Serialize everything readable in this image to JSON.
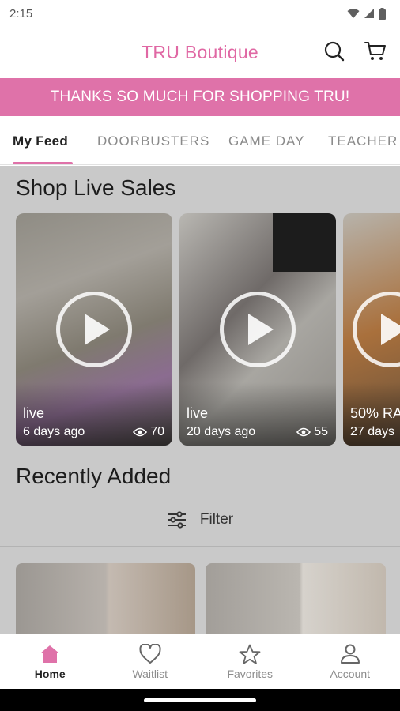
{
  "status_bar": {
    "time": "2:15"
  },
  "header": {
    "title": "TRU Boutique",
    "search_icon": "search-icon",
    "cart_icon": "cart-icon"
  },
  "banner": {
    "text": "THANKS SO MUCH FOR SHOPPING TRU!"
  },
  "tabs": [
    "My Feed",
    "DOORBUSTERS",
    "GAME DAY",
    "TEACHER"
  ],
  "live_sales": {
    "title": "Shop Live Sales",
    "cards": [
      {
        "title": "live",
        "date": "6 days ago",
        "views": "70"
      },
      {
        "title": "live",
        "date": "20 days ago",
        "views": "55"
      },
      {
        "title": "50% RA",
        "date": "27 days"
      }
    ]
  },
  "recently_added": {
    "title": "Recently Added",
    "filter_label": "Filter"
  },
  "bottom_nav": [
    {
      "label": "Home",
      "icon": "home-icon"
    },
    {
      "label": "Waitlist",
      "icon": "heart-icon"
    },
    {
      "label": "Favorites",
      "icon": "star-icon"
    },
    {
      "label": "Account",
      "icon": "account-icon"
    }
  ],
  "colors": {
    "brand_pink": "#df72a9",
    "title_pink": "#e068a4"
  }
}
